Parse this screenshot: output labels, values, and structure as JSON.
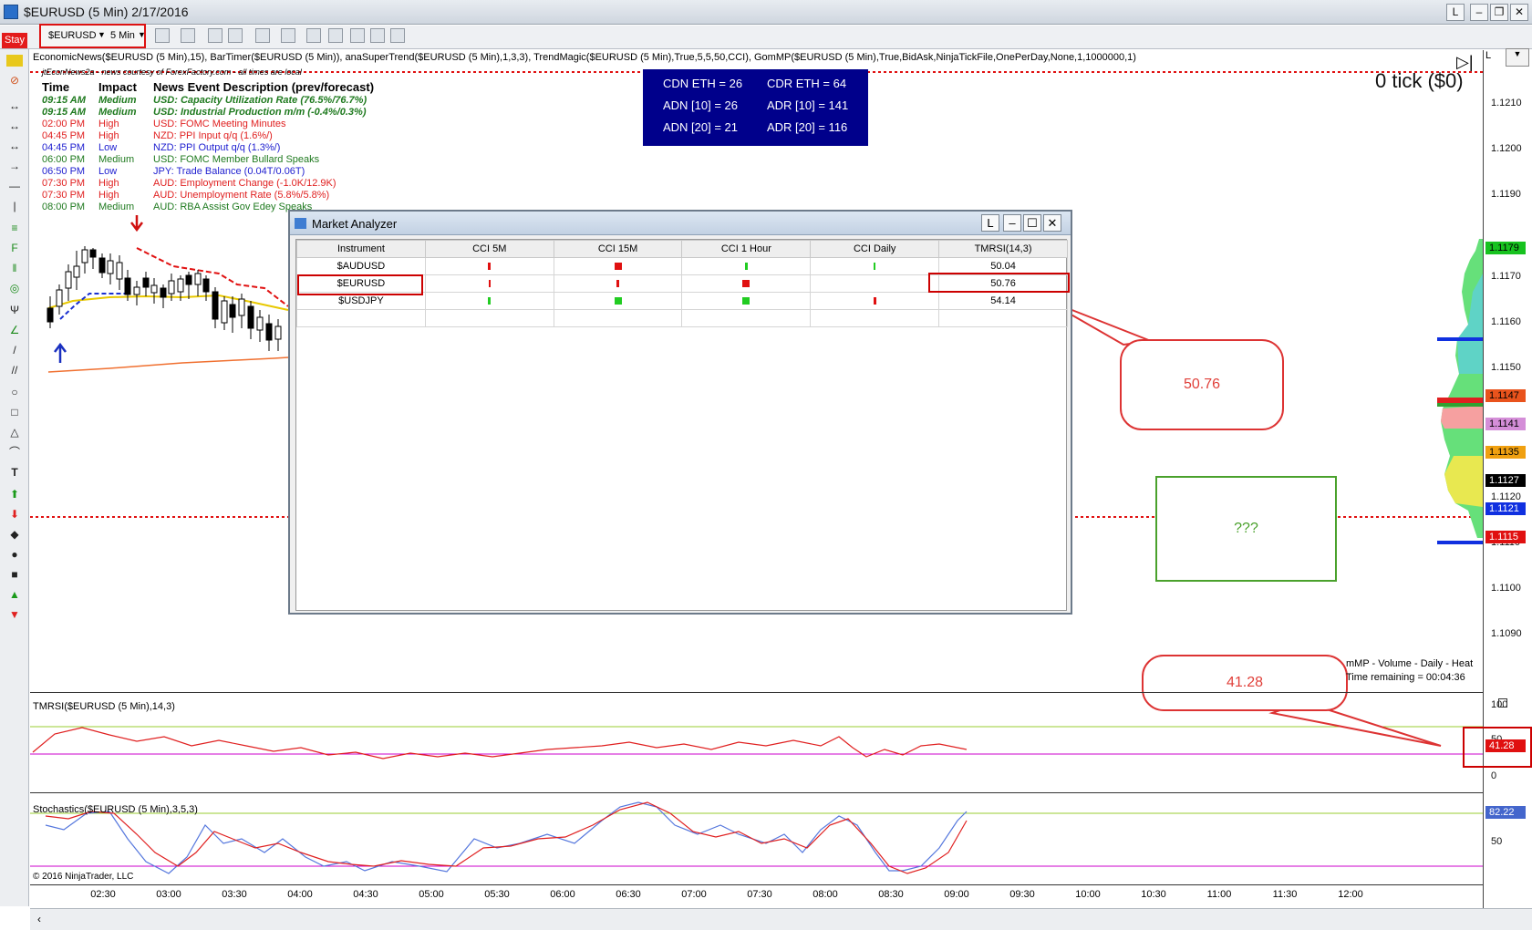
{
  "window": {
    "title": "$EURUSD (5 Min)  2/17/2016",
    "controls": [
      "L",
      "–",
      "❐",
      "✕"
    ]
  },
  "toolbar": {
    "stay_label": "Stay",
    "instrument": "$EURUSD",
    "timeframe": "5 Min"
  },
  "indicators_line": "EconomicNews($EURUSD (5 Min),15), BarTimer($EURUSD (5 Min)), anaSuperTrend($EURUSD (5 Min),1,3,3), TrendMagic($EURUSD (5 Min),True,5,5,50,CCI), GomMP($EURUSD (5 Min),True,BidAsk,NinjaTickFile,OnePerDay,None,1,1000000,1)",
  "news": {
    "credit": "jtEconNews2a - news courtesy of ForexFactory.com - all times are local",
    "headers": {
      "time": "Time",
      "impact": "Impact",
      "desc": "News Event Description (prev/forecast)"
    },
    "rows": [
      {
        "time": "09:15 AM",
        "impact": "Medium",
        "desc": "USD: Capacity Utilization Rate (76.5%/76.7%)",
        "color": "#1f7a1f",
        "italic": true
      },
      {
        "time": "09:15 AM",
        "impact": "Medium",
        "desc": "USD: Industrial Production m/m (-0.4%/0.3%)",
        "color": "#1f7a1f",
        "italic": true
      },
      {
        "time": "02:00 PM",
        "impact": "High",
        "desc": "USD: FOMC Meeting Minutes",
        "color": "#e02020",
        "italic": false
      },
      {
        "time": "04:45 PM",
        "impact": "High",
        "desc": "NZD: PPI Input q/q (1.6%/)",
        "color": "#e02020",
        "italic": false
      },
      {
        "time": "04:45 PM",
        "impact": "Low",
        "desc": "NZD: PPI Output q/q (1.3%/)",
        "color": "#2020d0",
        "italic": false
      },
      {
        "time": "06:00 PM",
        "impact": "Medium",
        "desc": "USD: FOMC Member Bullard Speaks",
        "color": "#1f7a1f",
        "italic": false
      },
      {
        "time": "06:50 PM",
        "impact": "Low",
        "desc": "JPY: Trade Balance (0.04T/0.06T)",
        "color": "#2020d0",
        "italic": false
      },
      {
        "time": "07:30 PM",
        "impact": "High",
        "desc": "AUD: Employment Change (-1.0K/12.9K)",
        "color": "#e02020",
        "italic": false
      },
      {
        "time": "07:30 PM",
        "impact": "High",
        "desc": "AUD: Unemployment Rate (5.8%/5.8%)",
        "color": "#e02020",
        "italic": false
      },
      {
        "time": "08:00 PM",
        "impact": "Medium",
        "desc": "AUD: RBA Assist Gov Edey Speaks",
        "color": "#1f7a1f",
        "italic": false
      }
    ]
  },
  "adr_box": {
    "cdn_eth": "CDN ETH = 26",
    "cdr_eth": "CDR ETH = 64",
    "adn10": "ADN [10] = 26",
    "adr10": "ADR [10] = 141",
    "adn20": "ADN [20] = 21",
    "adr20": "ADR [20] = 116"
  },
  "tick_label": "0 tick ($0)",
  "market_analyzer": {
    "title": "Market Analyzer",
    "columns": [
      "Instrument",
      "CCI 5M",
      "CCI 15M",
      "CCI 1 Hour",
      "CCI Daily",
      "TMRSI(14,3)"
    ],
    "rows": [
      {
        "instrument": "$AUDUSD",
        "cells": [
          [
            "red",
            "thin"
          ],
          [
            "red",
            "sq"
          ],
          [
            "green",
            "thin"
          ],
          [
            "green",
            "line"
          ]
        ],
        "tmrsi": "50.04"
      },
      {
        "instrument": "$EURUSD",
        "cells": [
          [
            "red",
            "line"
          ],
          [
            "red",
            "thin"
          ],
          [
            "red",
            "sq"
          ],
          [
            "none",
            ""
          ]
        ],
        "tmrsi": "50.76"
      },
      {
        "instrument": "$USDJPY",
        "cells": [
          [
            "green",
            "thin"
          ],
          [
            "green",
            "sq"
          ],
          [
            "green",
            "sq"
          ],
          [
            "red",
            "thin"
          ]
        ],
        "tmrsi": "54.14"
      }
    ]
  },
  "callouts": {
    "tmrsi_value": "50.76",
    "unknown": "???",
    "rsi_value": "41.28"
  },
  "price_axis": {
    "ticks": [
      "1.1210",
      "1.1200",
      "1.1190",
      "1.1170",
      "1.1160",
      "1.1150",
      "1.1130",
      "1.1120",
      "1.1110",
      "1.1100",
      "1.1090"
    ],
    "tags": [
      {
        "label": "1.1179",
        "color": "#17c21f"
      },
      {
        "label": "1.1147",
        "color": "#e9531c"
      },
      {
        "label": "1.1141",
        "color": "#d48ed8"
      },
      {
        "label": "1.1135",
        "color": "#f0a010"
      },
      {
        "label": "1.1127",
        "color": "#000000"
      },
      {
        "label": "1.1121",
        "color": "#1030e0"
      },
      {
        "label": "1.1115",
        "color": "#e01010"
      }
    ]
  },
  "gomp": {
    "label": "mMP - Volume - Daily - Heat",
    "time_remaining": "Time remaining = 00:04:36"
  },
  "tmrsi_pane": {
    "label": "TMRSI($EURUSD (5 Min),14,3)",
    "ticks": [
      "100",
      "50",
      "0"
    ],
    "tag": "41.28"
  },
  "stoch_pane": {
    "label": "Stochastics($EURUSD (5 Min),3,5,3)",
    "ticks": [
      "50"
    ],
    "tag": "82.22"
  },
  "time_axis": [
    "02:30",
    "03:00",
    "03:30",
    "04:00",
    "04:30",
    "05:00",
    "05:30",
    "06:00",
    "06:30",
    "07:00",
    "07:30",
    "08:00",
    "08:30",
    "09:00",
    "09:30",
    "10:00",
    "10:30",
    "11:00",
    "11:30",
    "12:00"
  ],
  "copyright": "© 2016 NinjaTrader, LLC"
}
